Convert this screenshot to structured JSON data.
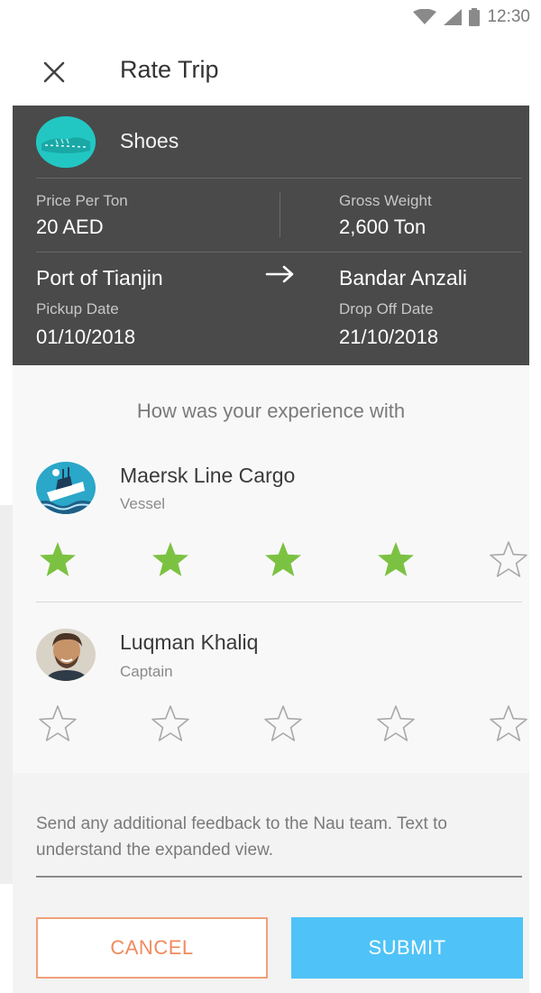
{
  "status_bar": {
    "time": "12:30"
  },
  "app_bar": {
    "title": "Rate Trip",
    "close_icon": "close-icon"
  },
  "trip": {
    "product": "Shoes",
    "price_label": "Price Per Ton",
    "price_value": "20 AED",
    "weight_label": "Gross Weight",
    "weight_value": "2,600 Ton",
    "origin": "Port of Tianjin",
    "destination": "Bandar Anzali",
    "pickup_label": "Pickup Date",
    "pickup_date": "01/10/2018",
    "dropoff_label": "Drop Off Date",
    "dropoff_date": "21/10/2018"
  },
  "rating": {
    "prompt": "How was your experience with",
    "entities": [
      {
        "name": "Maersk Line Cargo",
        "role": "Vessel",
        "rating": 4,
        "max": 5
      },
      {
        "name": "Luqman Khaliq",
        "role": "Captain",
        "rating": 0,
        "max": 5
      }
    ]
  },
  "feedback": {
    "text": "Send any additional feedback to the Nau team. Text to understand the expanded view."
  },
  "actions": {
    "cancel_label": "CANCEL",
    "submit_label": "SUBMIT"
  },
  "colors": {
    "star_filled": "#7cc242",
    "star_empty": "#a8a8a8",
    "submit": "#4fc3f7",
    "cancel": "#f08a5d",
    "card": "#4a4a4a"
  }
}
